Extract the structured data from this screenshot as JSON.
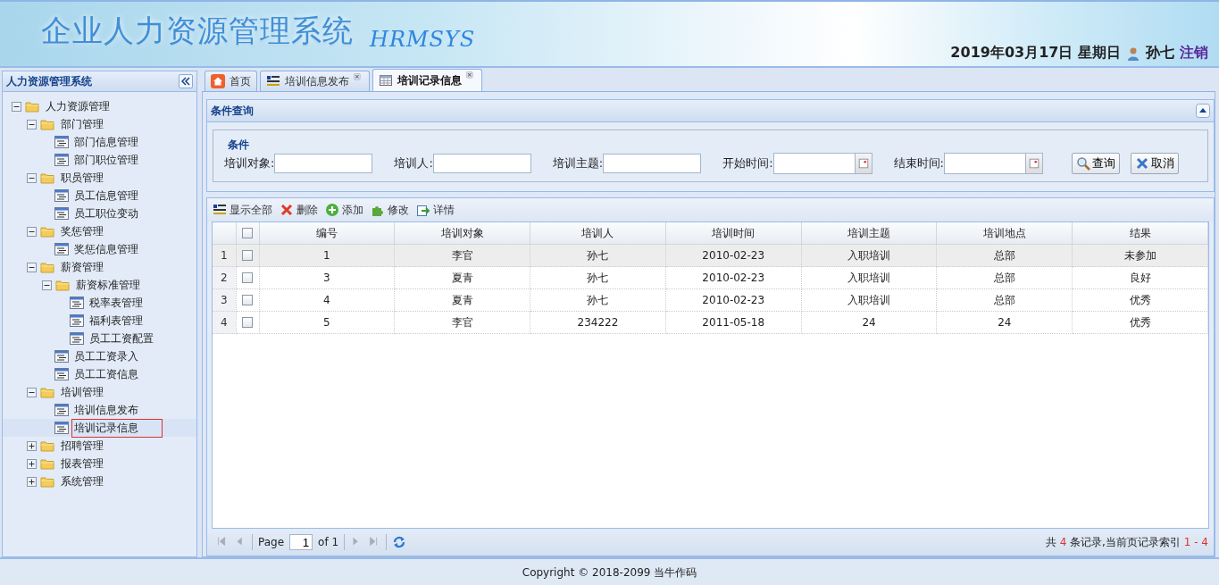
{
  "header": {
    "title": "企业人力资源管理系统",
    "subtitle": "HRMSYS",
    "date": "2019年03月17日 星期日",
    "user": "孙七",
    "logout": "注销"
  },
  "sidebar": {
    "title": "人力资源管理系统",
    "tree": [
      {
        "label": "人力资源管理",
        "kind": "folder",
        "expanded": true,
        "selected": false,
        "children": [
          {
            "label": "部门管理",
            "kind": "folder",
            "expanded": true,
            "selected": false,
            "children": [
              {
                "label": "部门信息管理",
                "kind": "leaf",
                "selected": false
              },
              {
                "label": "部门职位管理",
                "kind": "leaf",
                "selected": false
              }
            ]
          },
          {
            "label": "职员管理",
            "kind": "folder",
            "expanded": true,
            "selected": false,
            "children": [
              {
                "label": "员工信息管理",
                "kind": "leaf",
                "selected": false
              },
              {
                "label": "员工职位变动",
                "kind": "leaf",
                "selected": false
              }
            ]
          },
          {
            "label": "奖惩管理",
            "kind": "folder",
            "expanded": true,
            "selected": false,
            "children": [
              {
                "label": "奖惩信息管理",
                "kind": "leaf",
                "selected": false
              }
            ]
          },
          {
            "label": "薪资管理",
            "kind": "folder",
            "expanded": true,
            "selected": false,
            "children": [
              {
                "label": "薪资标准管理",
                "kind": "folder",
                "expanded": true,
                "selected": false,
                "children": [
                  {
                    "label": "税率表管理",
                    "kind": "leaf",
                    "selected": false
                  },
                  {
                    "label": "福利表管理",
                    "kind": "leaf",
                    "selected": false
                  },
                  {
                    "label": "员工工资配置",
                    "kind": "leaf",
                    "selected": false
                  }
                ]
              },
              {
                "label": "员工工资录入",
                "kind": "leaf",
                "selected": false
              },
              {
                "label": "员工工资信息",
                "kind": "leaf",
                "selected": false
              }
            ]
          },
          {
            "label": "培训管理",
            "kind": "folder",
            "expanded": true,
            "selected": false,
            "children": [
              {
                "label": "培训信息发布",
                "kind": "leaf",
                "selected": false
              },
              {
                "label": "培训记录信息",
                "kind": "leaf",
                "selected": true
              }
            ]
          },
          {
            "label": "招聘管理",
            "kind": "folder",
            "expanded": false,
            "selected": false
          },
          {
            "label": "报表管理",
            "kind": "folder",
            "expanded": false,
            "selected": false
          },
          {
            "label": "系统管理",
            "kind": "folder",
            "expanded": false,
            "selected": false
          }
        ]
      }
    ]
  },
  "tabs": [
    {
      "label": "首页",
      "kind": "home",
      "closable": false,
      "selected": false
    },
    {
      "label": "培训信息发布",
      "kind": "list",
      "closable": true,
      "selected": false
    },
    {
      "label": "培训记录信息",
      "kind": "grid",
      "closable": true,
      "selected": true
    }
  ],
  "query": {
    "title": "条件查询",
    "legend": "条件",
    "fields": [
      {
        "label": "培训对象:",
        "kind": "text"
      },
      {
        "label": "培训人:",
        "kind": "text"
      },
      {
        "label": "培训主题:",
        "kind": "text"
      },
      {
        "label": "开始时间:",
        "kind": "date"
      },
      {
        "label": "结束时间:",
        "kind": "date"
      }
    ],
    "buttons": [
      {
        "label": "查询",
        "kind": "search"
      },
      {
        "label": "取消",
        "kind": "cancel"
      }
    ]
  },
  "toolbar": [
    {
      "label": "显示全部",
      "kind": "list"
    },
    {
      "label": "删除",
      "kind": "delete"
    },
    {
      "label": "添加",
      "kind": "add"
    },
    {
      "label": "修改",
      "kind": "edit"
    },
    {
      "label": "详情",
      "kind": "detail"
    }
  ],
  "table": {
    "all_checked": false,
    "columns": [
      "编号",
      "培训对象",
      "培训人",
      "培训时间",
      "培训主题",
      "培训地点",
      "结果"
    ],
    "rows": [
      {
        "number": "1",
        "checked": false,
        "selected": true,
        "cells": [
          "1",
          "李官",
          "孙七",
          "2010-02-23",
          "入职培训",
          "总部",
          "未参加"
        ]
      },
      {
        "number": "2",
        "checked": false,
        "selected": false,
        "cells": [
          "3",
          "夏青",
          "孙七",
          "2010-02-23",
          "入职培训",
          "总部",
          "良好"
        ]
      },
      {
        "number": "3",
        "checked": false,
        "selected": false,
        "cells": [
          "4",
          "夏青",
          "孙七",
          "2010-02-23",
          "入职培训",
          "总部",
          "优秀"
        ]
      },
      {
        "number": "4",
        "checked": false,
        "selected": false,
        "cells": [
          "5",
          "李官",
          "234222",
          "2011-05-18",
          "24",
          "24",
          "优秀"
        ]
      }
    ]
  },
  "pager": {
    "page_label": "Page",
    "page": "1",
    "of": "of 1",
    "summary_prefix": "共",
    "count": "4",
    "summary_middle": "条记录,当前页记录索引",
    "range": "1 - 4"
  },
  "footer": {
    "copyright": "Copyright © 2018-2099 当牛作码"
  }
}
